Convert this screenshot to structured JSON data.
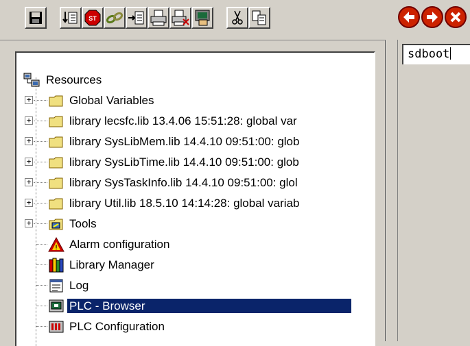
{
  "toolbar": {
    "buttons": [
      "save",
      "paste-list",
      "stop",
      "link",
      "insert",
      "print",
      "print-preview",
      "monitor",
      "cut",
      "copy",
      "back",
      "forward",
      "close"
    ]
  },
  "tree": {
    "root": {
      "label": "Resources",
      "icon": "resources-icon"
    },
    "items": [
      {
        "label": "Global Variables",
        "icon": "folder-icon",
        "expandable": true
      },
      {
        "label": "library lecsfc.lib 13.4.06 15:51:28: global var",
        "icon": "folder-icon",
        "expandable": true
      },
      {
        "label": "library SysLibMem.lib 14.4.10 09:51:00: glob",
        "icon": "folder-icon",
        "expandable": true
      },
      {
        "label": "library SysLibTime.lib 14.4.10 09:51:00: glob",
        "icon": "folder-icon",
        "expandable": true
      },
      {
        "label": "library SysTaskInfo.lib 14.4.10 09:51:00: glol",
        "icon": "folder-icon",
        "expandable": true
      },
      {
        "label": "library Util.lib 18.5.10 14:14:28: global variab",
        "icon": "folder-icon",
        "expandable": true
      },
      {
        "label": "Tools",
        "icon": "tools-icon",
        "expandable": true
      },
      {
        "label": "Alarm configuration",
        "icon": "alarm-icon",
        "expandable": false
      },
      {
        "label": "Library Manager",
        "icon": "library-manager-icon",
        "expandable": false
      },
      {
        "label": "Log",
        "icon": "log-icon",
        "expandable": false
      },
      {
        "label": "PLC - Browser",
        "icon": "plc-browser-icon",
        "expandable": false,
        "selected": true
      },
      {
        "label": "PLC Configuration",
        "icon": "plc-configuration-icon",
        "expandable": false
      }
    ]
  },
  "browser": {
    "command_value": "sdboot"
  },
  "colors": {
    "selection": "#0a246a",
    "window_bg": "#d4d0c8",
    "nav_button": "#cc2200"
  }
}
